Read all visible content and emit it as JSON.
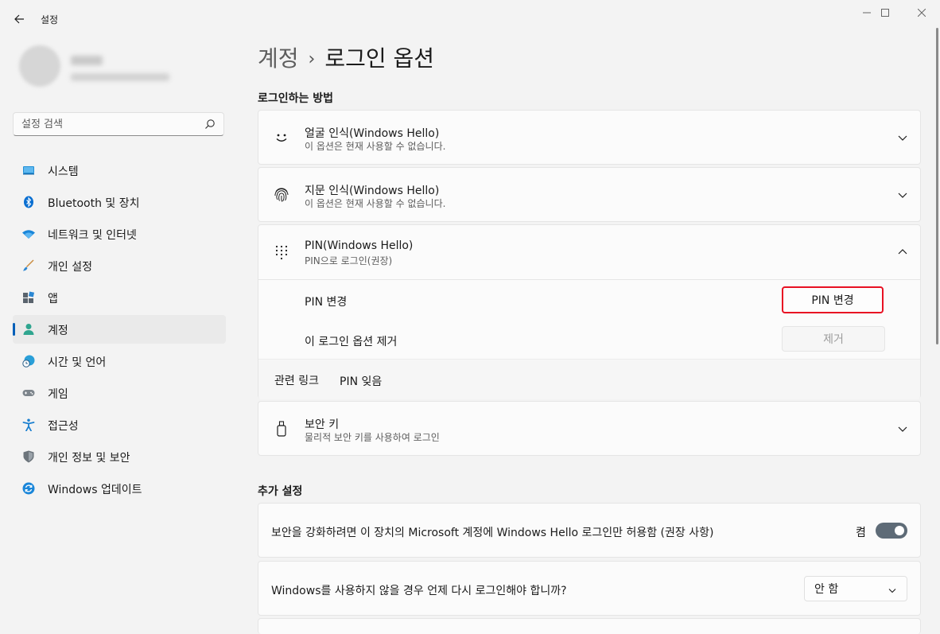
{
  "window": {
    "app_title": "설정",
    "controls": [
      "minimize-icon",
      "maximize-icon",
      "close-icon"
    ]
  },
  "search": {
    "placeholder": "설정 검색"
  },
  "nav": [
    {
      "label": "시스템",
      "icon": "system-icon"
    },
    {
      "label": "Bluetooth 및 장치",
      "icon": "bluetooth-icon"
    },
    {
      "label": "네트워크 및 인터넷",
      "icon": "wifi-icon"
    },
    {
      "label": "개인 설정",
      "icon": "brush-icon"
    },
    {
      "label": "앱",
      "icon": "apps-icon"
    },
    {
      "label": "계정",
      "icon": "account-icon",
      "selected": true
    },
    {
      "label": "시간 및 언어",
      "icon": "globe-clock-icon"
    },
    {
      "label": "게임",
      "icon": "gamepad-icon"
    },
    {
      "label": "접근성",
      "icon": "accessibility-icon"
    },
    {
      "label": "개인 정보 및 보안",
      "icon": "shield-icon"
    },
    {
      "label": "Windows 업데이트",
      "icon": "update-icon"
    }
  ],
  "breadcrumb": {
    "parent": "계정",
    "separator": "›",
    "current": "로그인 옵션"
  },
  "signin": {
    "heading": "로그인하는 방법",
    "face": {
      "title": "얼굴 인식(Windows Hello)",
      "subtitle": "이 옵션은 현재 사용할 수 없습니다."
    },
    "fingerprint": {
      "title": "지문 인식(Windows Hello)",
      "subtitle": "이 옵션은 현재 사용할 수 없습니다."
    },
    "pin": {
      "title": "PIN(Windows Hello)",
      "subtitle": "PIN으로 로그인(권장)",
      "change_label": "PIN 변경",
      "change_button": "PIN 변경",
      "remove_label": "이 로그인 옵션 제거",
      "remove_button": "제거",
      "related_label": "관련 링크",
      "forgot_link": "PIN 잊음"
    },
    "security_key": {
      "title": "보안 키",
      "subtitle": "물리적 보안 키를 사용하여 로그인"
    }
  },
  "additional": {
    "heading": "추가 설정",
    "hello_only": {
      "label": "보안을 강화하려면 이 장치의 Microsoft 계정에 Windows Hello 로그인만 허용함 (권장 사항)",
      "state": "켬",
      "on": true
    },
    "away": {
      "label": "Windows를 사용하지 않을 경우 언제 다시 로그인해야 합니까?",
      "selected": "안 함"
    }
  },
  "colors": {
    "accent": "#005fb8",
    "highlight_border": "#e81123",
    "toggle_on": "#5e6b77"
  }
}
